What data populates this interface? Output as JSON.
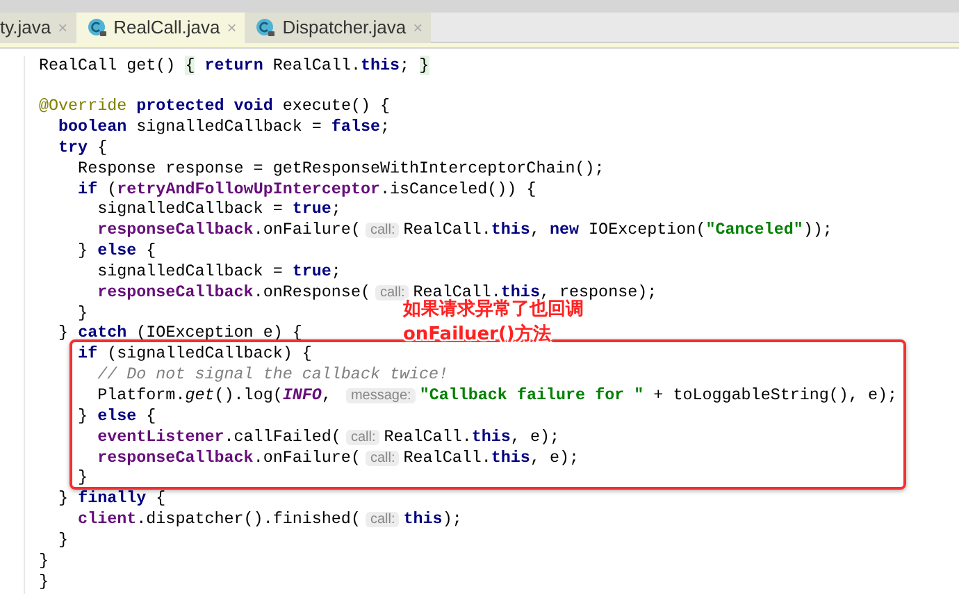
{
  "tabs": [
    {
      "label": "ty.java",
      "selected": false,
      "icon": false,
      "close": "×"
    },
    {
      "label": "RealCall.java",
      "selected": true,
      "icon": true,
      "close": "×"
    },
    {
      "label": "Dispatcher.java",
      "selected": false,
      "icon": true,
      "close": "×"
    }
  ],
  "code_lines": [
    {
      "tokens": [
        {
          "kind": "plain",
          "text": "RealCall get() "
        },
        {
          "kind": "brace-match",
          "text": "{"
        },
        {
          "kind": "keyword",
          "text": " return"
        },
        {
          "kind": "plain",
          "text": " RealCall."
        },
        {
          "kind": "keyword",
          "text": "this"
        },
        {
          "kind": "plain",
          "text": "; "
        },
        {
          "kind": "brace-match",
          "text": "}"
        }
      ]
    },
    {
      "blank_line_before": true,
      "tokens": [
        {
          "kind": "annotation",
          "text": "@Override"
        },
        {
          "kind": "keyword",
          "text": " protected void"
        },
        {
          "kind": "plain",
          "text": " execute() {"
        }
      ]
    },
    {
      "tokens": [
        {
          "kind": "keyword",
          "text": "  boolean"
        },
        {
          "kind": "plain",
          "text": " signalledCallback = "
        },
        {
          "kind": "keyword",
          "text": "false"
        },
        {
          "kind": "plain",
          "text": ";"
        }
      ]
    },
    {
      "tokens": [
        {
          "kind": "keyword",
          "text": "  try"
        },
        {
          "kind": "plain",
          "text": " {"
        }
      ]
    },
    {
      "tokens": [
        {
          "kind": "plain",
          "text": "    Response response = getResponseWithInterceptorChain();"
        }
      ]
    },
    {
      "tokens": [
        {
          "kind": "keyword",
          "text": "    if"
        },
        {
          "kind": "plain",
          "text": " ("
        },
        {
          "kind": "field",
          "text": "retryAndFollowUpInterceptor"
        },
        {
          "kind": "plain",
          "text": ".isCanceled()) {"
        }
      ]
    },
    {
      "tokens": [
        {
          "kind": "plain",
          "text": "      signalledCallback = "
        },
        {
          "kind": "keyword",
          "text": "true"
        },
        {
          "kind": "plain",
          "text": ";"
        }
      ]
    },
    {
      "tokens": [
        {
          "kind": "field",
          "text": "      responseCallback"
        },
        {
          "kind": "plain",
          "text": ".onFailure("
        },
        {
          "kind": "hint",
          "text": "call:"
        },
        {
          "kind": "plain",
          "text": "RealCall."
        },
        {
          "kind": "keyword",
          "text": "this"
        },
        {
          "kind": "plain",
          "text": ", "
        },
        {
          "kind": "keyword",
          "text": "new"
        },
        {
          "kind": "plain",
          "text": " IOException("
        },
        {
          "kind": "string",
          "text": "\"Canceled\""
        },
        {
          "kind": "plain",
          "text": "));"
        }
      ]
    },
    {
      "tokens": [
        {
          "kind": "plain",
          "text": "    } "
        },
        {
          "kind": "keyword",
          "text": "else"
        },
        {
          "kind": "plain",
          "text": " {"
        }
      ]
    },
    {
      "tokens": [
        {
          "kind": "plain",
          "text": "      signalledCallback = "
        },
        {
          "kind": "keyword",
          "text": "true"
        },
        {
          "kind": "plain",
          "text": ";"
        }
      ]
    },
    {
      "tokens": [
        {
          "kind": "field",
          "text": "      responseCallback"
        },
        {
          "kind": "plain",
          "text": ".onResponse("
        },
        {
          "kind": "hint",
          "text": "call:"
        },
        {
          "kind": "plain",
          "text": "RealCall."
        },
        {
          "kind": "keyword",
          "text": "this"
        },
        {
          "kind": "plain",
          "text": ", response);"
        }
      ]
    },
    {
      "tokens": [
        {
          "kind": "plain",
          "text": "    }"
        }
      ]
    },
    {
      "tokens": [
        {
          "kind": "plain",
          "text": "  } "
        },
        {
          "kind": "keyword",
          "text": "catch"
        },
        {
          "kind": "plain",
          "text": " (IOException e) {"
        }
      ]
    },
    {
      "tokens": [
        {
          "kind": "keyword",
          "text": "    if"
        },
        {
          "kind": "plain",
          "text": " (signalledCallback) {"
        }
      ]
    },
    {
      "tokens": [
        {
          "kind": "comment",
          "text": "      // Do not signal the callback twice!"
        }
      ]
    },
    {
      "tokens": [
        {
          "kind": "plain",
          "text": "      Platform."
        },
        {
          "kind": "static",
          "text": "get"
        },
        {
          "kind": "plain",
          "text": "().log("
        },
        {
          "kind": "constant",
          "text": "INFO"
        },
        {
          "kind": "plain",
          "text": ", "
        },
        {
          "kind": "hint",
          "text": "message:"
        },
        {
          "kind": "string",
          "text": "\"Callback failure for \""
        },
        {
          "kind": "plain",
          "text": " + toLoggableString(), e);"
        }
      ]
    },
    {
      "tokens": [
        {
          "kind": "plain",
          "text": "    } "
        },
        {
          "kind": "keyword",
          "text": "else"
        },
        {
          "kind": "plain",
          "text": " {"
        }
      ]
    },
    {
      "tokens": [
        {
          "kind": "field",
          "text": "      eventListener"
        },
        {
          "kind": "plain",
          "text": ".callFailed("
        },
        {
          "kind": "hint",
          "text": "call:"
        },
        {
          "kind": "plain",
          "text": "RealCall."
        },
        {
          "kind": "keyword",
          "text": "this"
        },
        {
          "kind": "plain",
          "text": ", e);"
        }
      ]
    },
    {
      "tokens": [
        {
          "kind": "field",
          "text": "      responseCallback"
        },
        {
          "kind": "plain",
          "text": ".onFailure("
        },
        {
          "kind": "hint",
          "text": "call:"
        },
        {
          "kind": "plain",
          "text": "RealCall."
        },
        {
          "kind": "keyword",
          "text": "this"
        },
        {
          "kind": "plain",
          "text": ", e);"
        }
      ]
    },
    {
      "tokens": [
        {
          "kind": "plain",
          "text": "    }"
        }
      ]
    },
    {
      "tokens": [
        {
          "kind": "plain",
          "text": "  } "
        },
        {
          "kind": "keyword",
          "text": "finally"
        },
        {
          "kind": "plain",
          "text": " {"
        }
      ]
    },
    {
      "tokens": [
        {
          "kind": "field",
          "text": "    client"
        },
        {
          "kind": "plain",
          "text": ".dispatcher().finished("
        },
        {
          "kind": "hint",
          "text": "call:"
        },
        {
          "kind": "keyword",
          "text": "this"
        },
        {
          "kind": "plain",
          "text": ");"
        }
      ]
    },
    {
      "tokens": [
        {
          "kind": "plain",
          "text": "  }"
        }
      ]
    },
    {
      "tokens": [
        {
          "kind": "plain",
          "text": "}"
        }
      ]
    },
    {
      "tokens": [
        {
          "kind": "plain",
          "text": "}"
        }
      ]
    }
  ],
  "callout": {
    "lines": [
      "如果请求异常了也回调",
      "onFailuer()方法"
    ]
  }
}
